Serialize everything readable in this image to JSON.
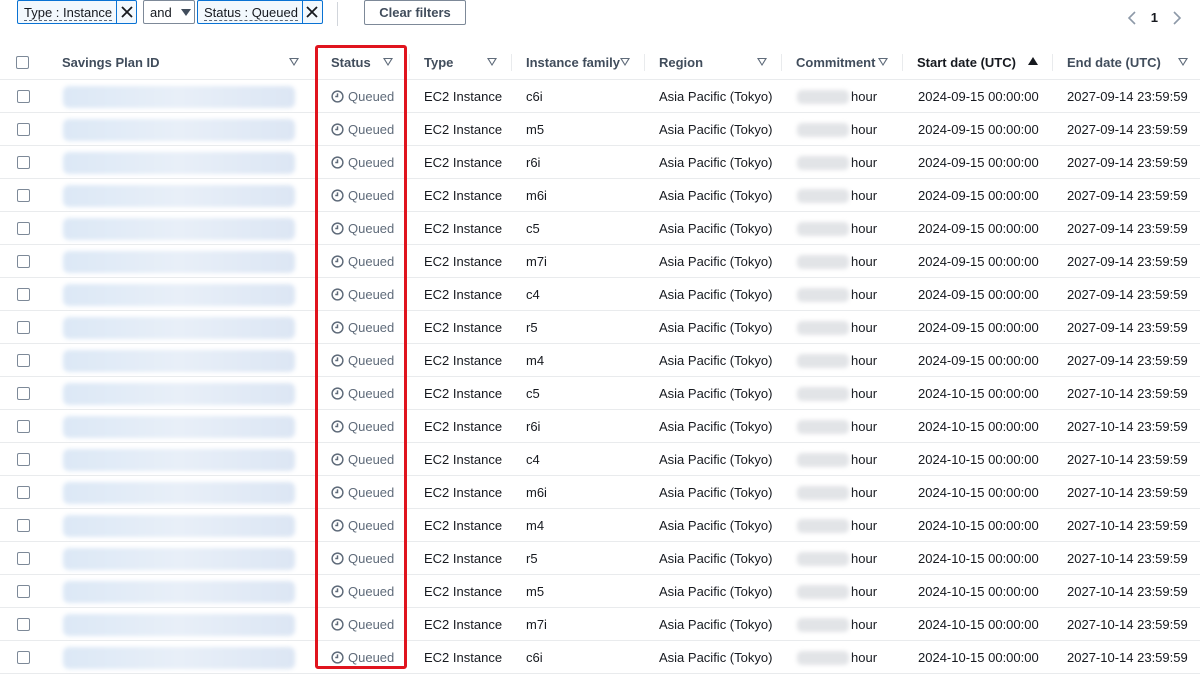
{
  "filters": {
    "tokens": [
      {
        "label": "Type : Instance"
      },
      {
        "label": "Status : Queued"
      }
    ],
    "operator": "and",
    "clear_label": "Clear filters"
  },
  "pagination": {
    "current_page": "1"
  },
  "columns": [
    {
      "label": "Savings Plan ID"
    },
    {
      "label": "Status"
    },
    {
      "label": "Type"
    },
    {
      "label": "Instance family"
    },
    {
      "label": "Region"
    },
    {
      "label": "Commitment"
    },
    {
      "label": "Start date (UTC)",
      "sort": "ascending"
    },
    {
      "label": "End date (UTC)"
    }
  ],
  "commitment_suffix": "hour",
  "rows": [
    {
      "status": "Queued",
      "type": "EC2 Instance",
      "family": "c6i",
      "region": "Asia Pacific (Tokyo)",
      "start": "2024-09-15 00:00:00",
      "end": "2027-09-14 23:59:59"
    },
    {
      "status": "Queued",
      "type": "EC2 Instance",
      "family": "m5",
      "region": "Asia Pacific (Tokyo)",
      "start": "2024-09-15 00:00:00",
      "end": "2027-09-14 23:59:59"
    },
    {
      "status": "Queued",
      "type": "EC2 Instance",
      "family": "r6i",
      "region": "Asia Pacific (Tokyo)",
      "start": "2024-09-15 00:00:00",
      "end": "2027-09-14 23:59:59"
    },
    {
      "status": "Queued",
      "type": "EC2 Instance",
      "family": "m6i",
      "region": "Asia Pacific (Tokyo)",
      "start": "2024-09-15 00:00:00",
      "end": "2027-09-14 23:59:59"
    },
    {
      "status": "Queued",
      "type": "EC2 Instance",
      "family": "c5",
      "region": "Asia Pacific (Tokyo)",
      "start": "2024-09-15 00:00:00",
      "end": "2027-09-14 23:59:59"
    },
    {
      "status": "Queued",
      "type": "EC2 Instance",
      "family": "m7i",
      "region": "Asia Pacific (Tokyo)",
      "start": "2024-09-15 00:00:00",
      "end": "2027-09-14 23:59:59"
    },
    {
      "status": "Queued",
      "type": "EC2 Instance",
      "family": "c4",
      "region": "Asia Pacific (Tokyo)",
      "start": "2024-09-15 00:00:00",
      "end": "2027-09-14 23:59:59"
    },
    {
      "status": "Queued",
      "type": "EC2 Instance",
      "family": "r5",
      "region": "Asia Pacific (Tokyo)",
      "start": "2024-09-15 00:00:00",
      "end": "2027-09-14 23:59:59"
    },
    {
      "status": "Queued",
      "type": "EC2 Instance",
      "family": "m4",
      "region": "Asia Pacific (Tokyo)",
      "start": "2024-09-15 00:00:00",
      "end": "2027-09-14 23:59:59"
    },
    {
      "status": "Queued",
      "type": "EC2 Instance",
      "family": "c5",
      "region": "Asia Pacific (Tokyo)",
      "start": "2024-10-15 00:00:00",
      "end": "2027-10-14 23:59:59"
    },
    {
      "status": "Queued",
      "type": "EC2 Instance",
      "family": "r6i",
      "region": "Asia Pacific (Tokyo)",
      "start": "2024-10-15 00:00:00",
      "end": "2027-10-14 23:59:59"
    },
    {
      "status": "Queued",
      "type": "EC2 Instance",
      "family": "c4",
      "region": "Asia Pacific (Tokyo)",
      "start": "2024-10-15 00:00:00",
      "end": "2027-10-14 23:59:59"
    },
    {
      "status": "Queued",
      "type": "EC2 Instance",
      "family": "m6i",
      "region": "Asia Pacific (Tokyo)",
      "start": "2024-10-15 00:00:00",
      "end": "2027-10-14 23:59:59"
    },
    {
      "status": "Queued",
      "type": "EC2 Instance",
      "family": "m4",
      "region": "Asia Pacific (Tokyo)",
      "start": "2024-10-15 00:00:00",
      "end": "2027-10-14 23:59:59"
    },
    {
      "status": "Queued",
      "type": "EC2 Instance",
      "family": "r5",
      "region": "Asia Pacific (Tokyo)",
      "start": "2024-10-15 00:00:00",
      "end": "2027-10-14 23:59:59"
    },
    {
      "status": "Queued",
      "type": "EC2 Instance",
      "family": "m5",
      "region": "Asia Pacific (Tokyo)",
      "start": "2024-10-15 00:00:00",
      "end": "2027-10-14 23:59:59"
    },
    {
      "status": "Queued",
      "type": "EC2 Instance",
      "family": "m7i",
      "region": "Asia Pacific (Tokyo)",
      "start": "2024-10-15 00:00:00",
      "end": "2027-10-14 23:59:59"
    },
    {
      "status": "Queued",
      "type": "EC2 Instance",
      "family": "c6i",
      "region": "Asia Pacific (Tokyo)",
      "start": "2024-10-15 00:00:00",
      "end": "2027-10-14 23:59:59"
    }
  ],
  "colors": {
    "accent": "#0972d3",
    "highlight": "#e0141e",
    "status_text": "#5f6b7a"
  },
  "icons": {
    "token_remove": "close-icon",
    "status": "clock-icon",
    "operator_caret": "caret-down-icon",
    "prev": "chevron-left-icon",
    "next": "chevron-right-icon"
  }
}
